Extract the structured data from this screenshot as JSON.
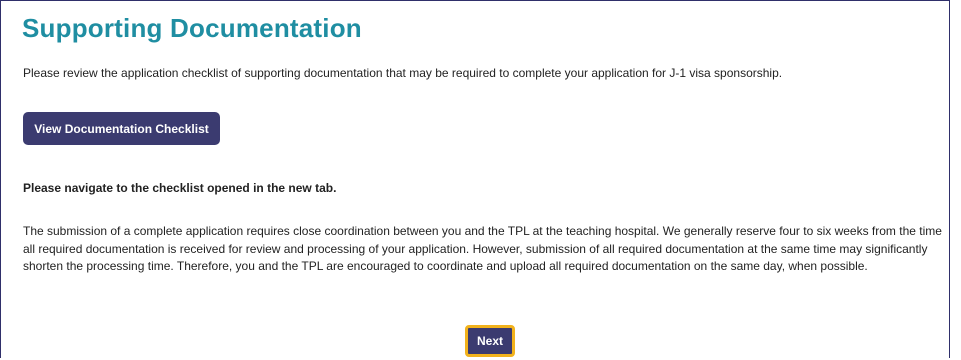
{
  "page": {
    "title": "Supporting Documentation",
    "intro": "Please review the application checklist of supporting documentation that may be required to complete your application for J-1 visa sponsorship.",
    "checklist_button_label": "View Documentation Checklist",
    "navigate_note": "Please navigate to the checklist opened in the new tab.",
    "body": "The submission of a complete application requires close coordination between you and the TPL at the teaching hospital. We generally reserve four to six weeks from the time all required documentation is received for review and processing of your application. However, submission of all required documentation at the same time may significantly shorten the processing time. Therefore, you and the TPL are encouraged to coordinate and upload all required documentation on the same day, when possible.",
    "next_button_label": "Next"
  },
  "colors": {
    "title": "#1f8ea2",
    "button_bg": "#3b3b70",
    "focus_outline": "#f2b21c",
    "frame_border": "#2f2f6a"
  }
}
